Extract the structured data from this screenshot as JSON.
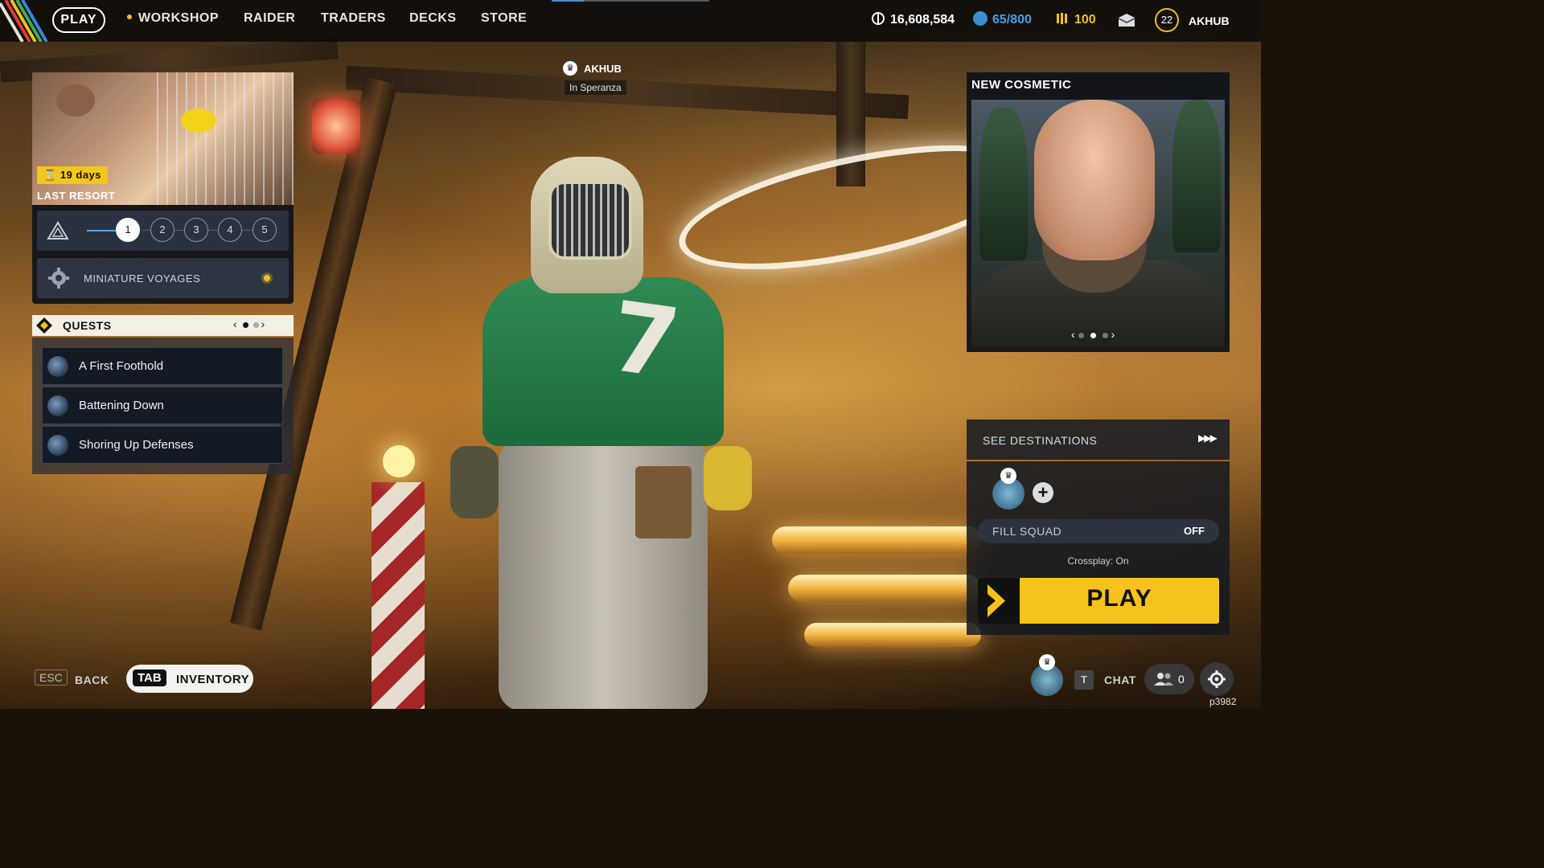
{
  "nav": {
    "play": "PLAY",
    "items": [
      "WORKSHOP",
      "RAIDER",
      "TRADERS",
      "DECKS",
      "STORE"
    ],
    "credits": "16,608,584",
    "tokens": "65/800",
    "coins": "100",
    "level": "22",
    "username": "AKHUB"
  },
  "player_tag": {
    "name": "AKHUB",
    "location": "In Speranza"
  },
  "last_resort": {
    "timer": "19 days",
    "title": "LAST RESORT",
    "steps": [
      "1",
      "2",
      "3",
      "4",
      "5"
    ],
    "active_step": 1,
    "reward": "MINIATURE VOYAGES"
  },
  "quests": {
    "title": "QUESTS",
    "items": [
      "A First Foothold",
      "Battening Down",
      "Shoring Up Defenses"
    ]
  },
  "cosmetic": {
    "title": "NEW COSMETIC"
  },
  "matchmaking": {
    "see_destinations": "SEE DESTINATIONS",
    "fill_squad": "FILL SQUAD",
    "fill_squad_value": "OFF",
    "crossplay": "Crossplay: On",
    "play": "PLAY"
  },
  "bottom": {
    "esc_key": "ESC",
    "back": "BACK",
    "tab_key": "TAB",
    "inventory": "INVENTORY",
    "chat_key": "T",
    "chat": "CHAT",
    "friends_count": "0",
    "build": "p3982"
  },
  "colors": {
    "accent_yellow": "#f5c31b",
    "accent_blue": "#4a8ed8",
    "panel_dark": "#0e121a"
  }
}
